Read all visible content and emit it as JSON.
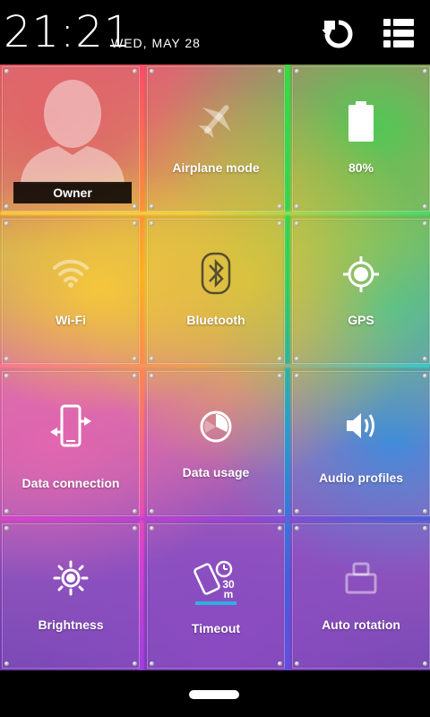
{
  "status_bar": {
    "time": "21:21",
    "date": "WED, MAY 28",
    "icons": [
      "refresh-icon",
      "list-menu-icon"
    ]
  },
  "tiles": [
    {
      "name": "owner",
      "label": "Owner",
      "icon": "user-silhouette-icon"
    },
    {
      "name": "airplane-mode",
      "label": "Airplane mode",
      "icon": "airplane-icon",
      "state": "off"
    },
    {
      "name": "battery",
      "label": "80%",
      "icon": "battery-icon",
      "level": 0.8
    },
    {
      "name": "wifi",
      "label": "Wi-Fi",
      "icon": "wifi-icon",
      "state": "off"
    },
    {
      "name": "bluetooth",
      "label": "Bluetooth",
      "icon": "bluetooth-icon",
      "state": "off"
    },
    {
      "name": "gps",
      "label": "GPS",
      "icon": "gps-icon",
      "state": "on"
    },
    {
      "name": "data-connection",
      "label": "Data connection",
      "icon": "data-connection-icon",
      "state": "on"
    },
    {
      "name": "data-usage",
      "label": "Data usage",
      "icon": "pie-clock-icon"
    },
    {
      "name": "audio-profiles",
      "label": "Audio profiles",
      "icon": "speaker-icon"
    },
    {
      "name": "brightness",
      "label": "Brightness",
      "icon": "sun-icon"
    },
    {
      "name": "timeout",
      "label": "Timeout",
      "icon": "phone-timer-icon",
      "badge": "30 m"
    },
    {
      "name": "auto-rotation",
      "label": "Auto rotation",
      "icon": "rotation-icon",
      "state": "off"
    }
  ],
  "colors": {
    "status_bar_bg": "#000000",
    "nav_bar_bg": "#000000",
    "label": "#ffffff"
  }
}
